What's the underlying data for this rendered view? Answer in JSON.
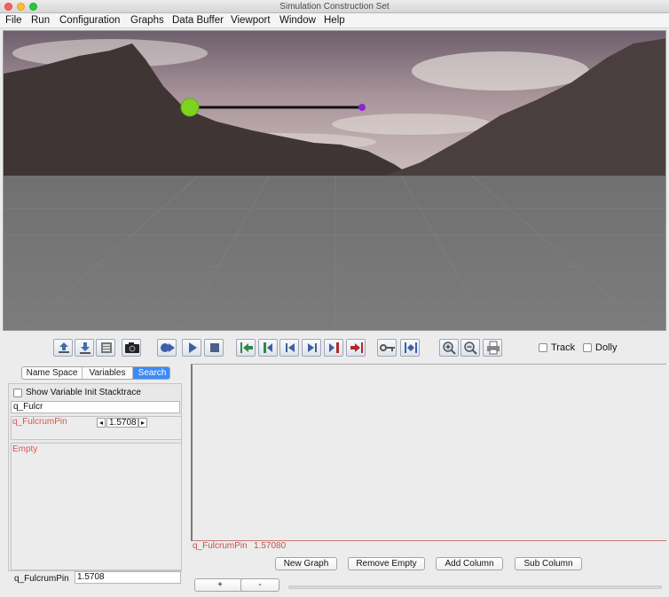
{
  "window": {
    "title": "Simulation Construction Set"
  },
  "menu": [
    "File",
    "Run",
    "Configuration",
    "Graphs",
    "Data Buffer",
    "Viewport",
    "Window",
    "Help"
  ],
  "toolbar": {
    "buttons": [
      "export-icon",
      "import-icon",
      "media-icon",
      "camera-icon",
      "simulate-icon",
      "play-icon",
      "stop-icon",
      "goto-in-point-icon",
      "set-in-point-icon",
      "step-backward-icon",
      "step-forward-icon",
      "set-out-point-icon",
      "goto-out-point-icon",
      "key-icon",
      "key-frames-icon",
      "zoom-in-icon",
      "zoom-out-icon",
      "print-icon"
    ],
    "track_label": "Track",
    "dolly_label": "Dolly"
  },
  "left_panel": {
    "tabs": [
      "Name Space",
      "Variables",
      "Search"
    ],
    "active_tab": "Search",
    "stacktrace_label": "Show Variable Init Stacktrace",
    "search_value": "q_Fulcr",
    "result_var_name": "q_FulcrumPin",
    "result_var_value": "1.5708",
    "empty_label": "Empty",
    "bottom_var_name": "q_FulcrumPin",
    "bottom_var_value": "1.5708"
  },
  "graph_panel": {
    "entry_label": "q_FulcrumPin",
    "entry_value": "1.57080"
  },
  "buttons": {
    "new_graph": "New Graph",
    "remove_empty": "Remove Empty",
    "add_column": "Add Column",
    "sub_column": "Sub Column",
    "plus": "+",
    "minus": "-"
  },
  "colors": {
    "accent": "#3a8bf5",
    "variable_red": "#d8574f",
    "ball_green": "#7ed321",
    "ball_purple": "#8b22d8"
  }
}
